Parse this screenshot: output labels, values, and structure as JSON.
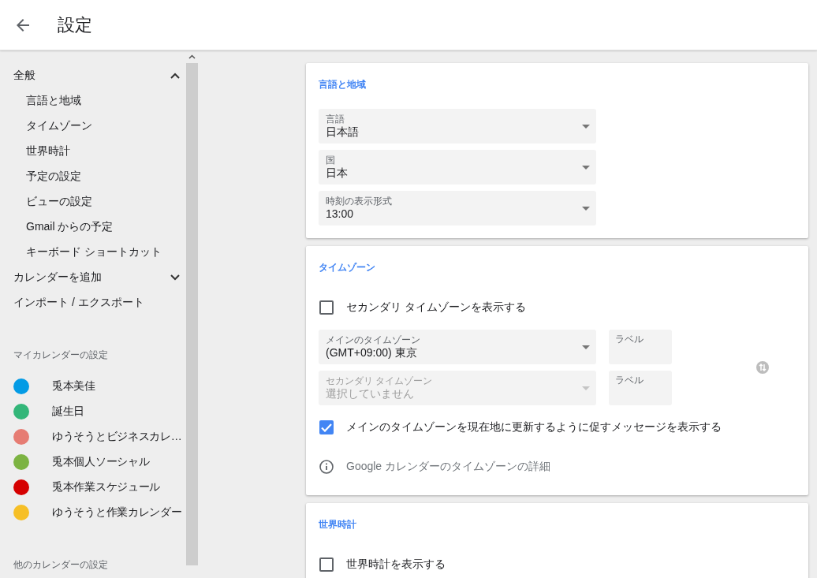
{
  "header": {
    "title": "設定"
  },
  "sidebar": {
    "sections": [
      {
        "label": "全般",
        "expanded": true,
        "children": [
          {
            "label": "言語と地域"
          },
          {
            "label": "タイムゾーン"
          },
          {
            "label": "世界時計"
          },
          {
            "label": "予定の設定"
          },
          {
            "label": "ビューの設定"
          },
          {
            "label": "Gmail からの予定"
          },
          {
            "label": "キーボード ショートカット"
          }
        ]
      },
      {
        "label": "カレンダーを追加",
        "expanded": false
      },
      {
        "label": "インポート / エクスポート"
      }
    ],
    "my_calendars": {
      "title": "マイカレンダーの設定",
      "items": [
        {
          "name": "兎本美佳",
          "color": "#039be5"
        },
        {
          "name": "誕生日",
          "color": "#33b679"
        },
        {
          "name": "ゆうそうとビジネスカレ…",
          "color": "#e67c73"
        },
        {
          "name": "兎本個人ソーシャル",
          "color": "#7cb342"
        },
        {
          "name": "兎本作業スケジュール",
          "color": "#d50000"
        },
        {
          "name": "ゆうそうと作業カレンダー",
          "color": "#f6bf26"
        }
      ]
    },
    "other_calendars": {
      "title": "他のカレンダーの設定"
    }
  },
  "cards": [
    {
      "title": "言語と地域",
      "rows": [
        {
          "kind": "select",
          "label": "言語",
          "value": "日本語",
          "disabled": false
        },
        {
          "kind": "select",
          "label": "国",
          "value": "日本",
          "disabled": false
        },
        {
          "kind": "select",
          "label": "時刻の表示形式",
          "value": "13:00",
          "disabled": false
        }
      ]
    },
    {
      "title": "タイムゾーン",
      "rows": [
        {
          "kind": "checkbox",
          "label": "セカンダリ タイムゾーンを表示する",
          "checked": false
        },
        {
          "kind": "timezones",
          "fields": [
            {
              "label": "メインのタイムゾーン",
              "value": "(GMT+09:00) 東京",
              "disabled": false,
              "tag": {
                "placeholder": "ラベル"
              }
            },
            {
              "label": "セカンダリ タイムゾーン",
              "value": "選択していません",
              "disabled": true,
              "tag": {
                "placeholder": "ラベル"
              }
            }
          ]
        },
        {
          "kind": "checkbox",
          "label": "メインのタイムゾーンを現在地に更新するように促すメッセージを表示する",
          "checked": true
        },
        {
          "kind": "info",
          "text": "Google カレンダーのタイムゾーンの詳細"
        }
      ]
    },
    {
      "title": "世界時計",
      "rows": [
        {
          "kind": "checkbox",
          "label": "世界時計を表示する",
          "checked": false
        }
      ]
    }
  ]
}
